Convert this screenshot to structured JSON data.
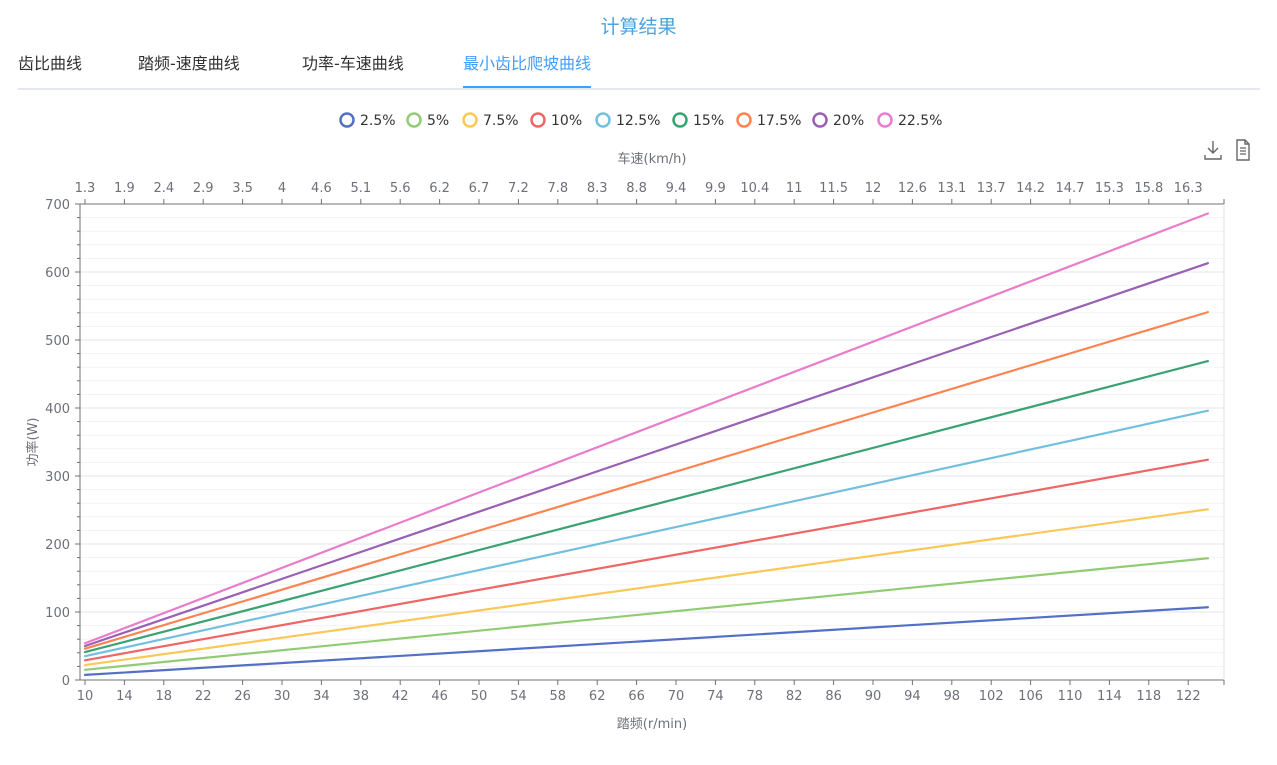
{
  "header": {
    "title": "计算结果"
  },
  "tabs": [
    {
      "label": "齿比曲线",
      "active": false
    },
    {
      "label": "踏频-速度曲线",
      "active": false
    },
    {
      "label": "功率-车速曲线",
      "active": false
    },
    {
      "label": "最小齿比爬坡曲线",
      "active": true
    }
  ],
  "toolbox": {
    "icons": [
      "download-icon",
      "data-view-icon"
    ]
  },
  "chart_data": {
    "type": "line",
    "title": "",
    "xlabel": "踏频(r/min)",
    "ylabel": "功率(W)",
    "x2label": "车速(km/h)",
    "legend_position": "top-center",
    "grid": true,
    "xlim": [
      10,
      124
    ],
    "ylim": [
      0,
      700
    ],
    "x_ticks": [
      "10",
      "14",
      "18",
      "22",
      "26",
      "30",
      "34",
      "38",
      "42",
      "46",
      "50",
      "54",
      "58",
      "62",
      "66",
      "70",
      "74",
      "78",
      "82",
      "86",
      "90",
      "94",
      "98",
      "102",
      "106",
      "110",
      "114",
      "118",
      "122"
    ],
    "x2_ticks": [
      "1.3",
      "1.9",
      "2.4",
      "2.9",
      "3.5",
      "4",
      "4.6",
      "5.1",
      "5.6",
      "6.2",
      "6.7",
      "7.2",
      "7.8",
      "8.3",
      "8.8",
      "9.4",
      "9.9",
      "10.4",
      "11",
      "11.5",
      "12",
      "12.6",
      "13.1",
      "13.7",
      "14.2",
      "14.7",
      "15.3",
      "15.8",
      "16.3"
    ],
    "y_ticks": [
      "0",
      "100",
      "200",
      "300",
      "400",
      "500",
      "600",
      "700"
    ],
    "x": [
      10,
      124
    ],
    "series": [
      {
        "name": "2.5%",
        "color": "#5470c6",
        "values": [
          7.5,
          107
        ]
      },
      {
        "name": "5%",
        "color": "#91cc75",
        "values": [
          15,
          179
        ]
      },
      {
        "name": "7.5%",
        "color": "#fac858",
        "values": [
          22,
          251
        ]
      },
      {
        "name": "10%",
        "color": "#ee6666",
        "values": [
          29,
          324
        ]
      },
      {
        "name": "12.5%",
        "color": "#73c0de",
        "values": [
          35,
          396
        ]
      },
      {
        "name": "15%",
        "color": "#3ba272",
        "values": [
          41,
          469
        ]
      },
      {
        "name": "17.5%",
        "color": "#fc8452",
        "values": [
          46,
          541
        ]
      },
      {
        "name": "20%",
        "color": "#9a60b4",
        "values": [
          50,
          613
        ]
      },
      {
        "name": "22.5%",
        "color": "#ea7ccc",
        "values": [
          54,
          686
        ]
      }
    ]
  }
}
